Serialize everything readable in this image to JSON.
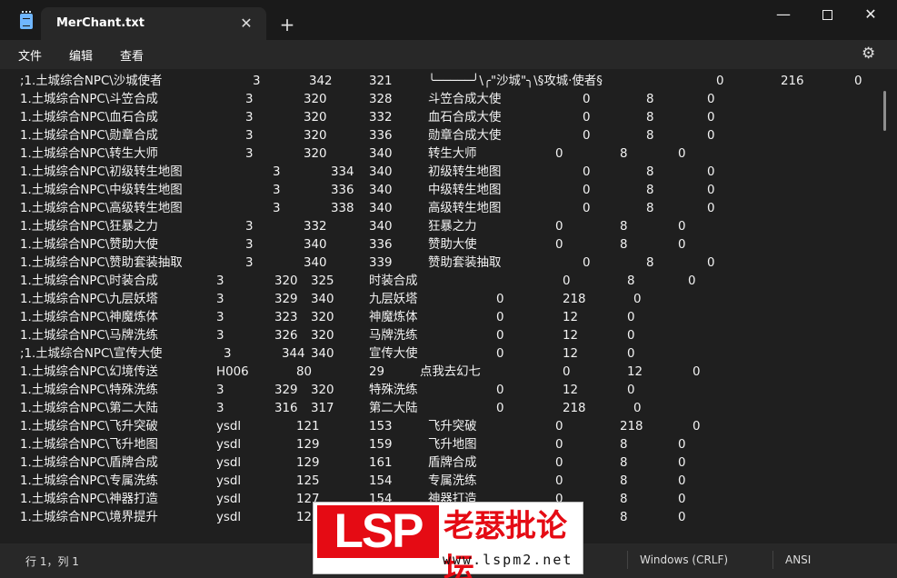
{
  "window": {
    "tab_title": "MerChant.txt",
    "tab_close": "✕",
    "new_tab": "+",
    "minimize": "—",
    "close": "✕"
  },
  "menu": {
    "file": "文件",
    "edit": "编辑",
    "view": "查看"
  },
  "icons": {
    "app": "notepad-icon",
    "settings": "gear-icon"
  },
  "lines": [
    [
      ";1.土城综合NPC\\沙城使者",
      "3",
      "342",
      "321",
      "╰─────╯\\╭\"沙城\"╮\\§攻城·使者§",
      "0",
      "216",
      "0"
    ],
    [
      "1.土城综合NPC\\斗笠合成",
      "3",
      "320",
      "328",
      "斗笠合成大使",
      "0",
      "8",
      "0"
    ],
    [
      "1.土城综合NPC\\血石合成",
      "3",
      "320",
      "332",
      "血石合成大使",
      "0",
      "8",
      "0"
    ],
    [
      "1.土城综合NPC\\勋章合成",
      "3",
      "320",
      "336",
      "勋章合成大使",
      "0",
      "8",
      "0"
    ],
    [
      "1.土城综合NPC\\转生大师",
      "3",
      "320",
      "340",
      "转生大师",
      "0",
      "8",
      "0"
    ],
    [
      "1.土城综合NPC\\初级转生地图",
      "3",
      "334",
      "340",
      "初级转生地图",
      "0",
      "8",
      "0"
    ],
    [
      "1.土城综合NPC\\中级转生地图",
      "3",
      "336",
      "340",
      "中级转生地图",
      "0",
      "8",
      "0"
    ],
    [
      "1.土城综合NPC\\高级转生地图",
      "3",
      "338",
      "340",
      "高级转生地图",
      "0",
      "8",
      "0"
    ],
    [
      "1.土城综合NPC\\狂暴之力",
      "3",
      "332",
      "340",
      "狂暴之力",
      "0",
      "8",
      "0"
    ],
    [
      "1.土城综合NPC\\赞助大使",
      "3",
      "340",
      "336",
      "赞助大使",
      "0",
      "8",
      "0"
    ],
    [
      "1.土城综合NPC\\赞助套装抽取",
      "3",
      "340",
      "339",
      "赞助套装抽取",
      "0",
      "8",
      "0"
    ],
    [
      "1.土城综合NPC\\时装合成",
      "3",
      "320",
      "325",
      "时装合成",
      "0",
      "8",
      "0"
    ],
    [
      "1.土城综合NPC\\九层妖塔",
      "3",
      "329",
      "340",
      "九层妖塔",
      "0",
      "218",
      "0"
    ],
    [
      "1.土城综合NPC\\神魔炼体",
      "3",
      "323",
      "320",
      "神魔炼体",
      "0",
      "12",
      "0"
    ],
    [
      "1.土城综合NPC\\马牌洗练",
      "3",
      "326",
      "320",
      "马牌洗练",
      "0",
      "12",
      "0"
    ],
    [
      ";1.土城综合NPC\\宣传大使",
      "3",
      "344",
      "340",
      "宣传大使",
      "0",
      "12",
      "0"
    ],
    [
      "1.土城综合NPC\\幻境传送",
      "H006",
      "80",
      "29",
      "点我去幻七",
      "0",
      "12",
      "0"
    ],
    [
      "1.土城综合NPC\\特殊洗练",
      "3",
      "329",
      "320",
      "特殊洗练",
      "0",
      "12",
      "0"
    ],
    [
      "1.土城综合NPC\\第二大陆",
      "3",
      "316",
      "317",
      "第二大陆",
      "0",
      "218",
      "0"
    ],
    [
      "1.土城综合NPC\\飞升突破",
      "ysdl",
      "121",
      "153",
      "飞升突破",
      "0",
      "218",
      "0"
    ],
    [
      "1.土城综合NPC\\飞升地图",
      "ysdl",
      "129",
      "159",
      "飞升地图",
      "0",
      "8",
      "0"
    ],
    [
      "1.土城综合NPC\\盾牌合成",
      "ysdl",
      "129",
      "161",
      "盾牌合成",
      "0",
      "8",
      "0"
    ],
    [
      "1.土城综合NPC\\专属洗练",
      "ysdl",
      "125",
      "154",
      "专属洗练",
      "0",
      "8",
      "0"
    ],
    [
      "1.土城综合NPC\\神器打造",
      "ysdl",
      "127",
      "154",
      "神器打造",
      "0",
      "8",
      "0"
    ],
    [
      "1.土城综合NPC\\境界提升",
      "ysdl",
      "12",
      "",
      "",
      "",
      "8",
      "0"
    ]
  ],
  "status": {
    "position": "行 1，列 1",
    "line_ending": "Windows (CRLF)",
    "encoding": "ANSI"
  },
  "watermark": {
    "logo": "LSP",
    "name": "老瑟批论坛",
    "url": "www.lspm2.net"
  }
}
